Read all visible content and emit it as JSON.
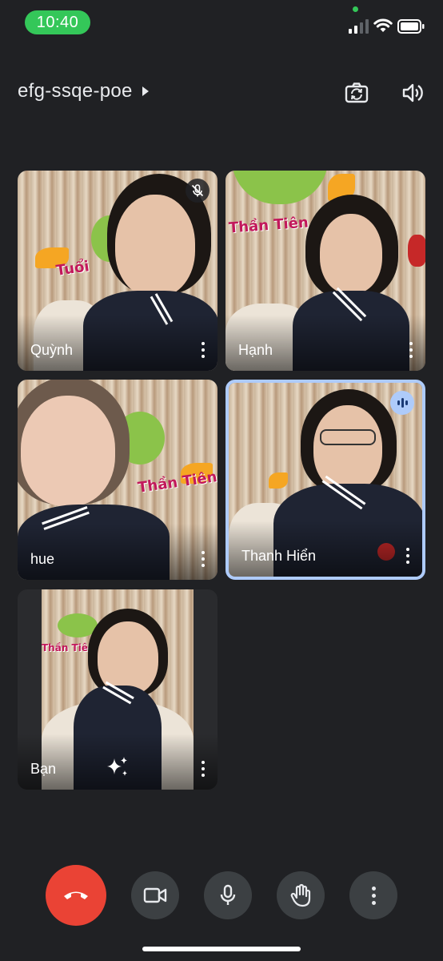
{
  "status_bar": {
    "time": "10:40"
  },
  "header": {
    "meeting_code": "efg-ssqe-poe"
  },
  "participants": [
    {
      "name": "Quỳnh",
      "muted": true,
      "speaking": false
    },
    {
      "name": "Hạnh",
      "muted": false,
      "speaking": false
    },
    {
      "name": "hue",
      "muted": false,
      "speaking": false
    },
    {
      "name": "Thanh Hiển",
      "muted": false,
      "speaking": true
    },
    {
      "name": "Bạn",
      "muted": false,
      "speaking": false,
      "self": true
    }
  ],
  "backdrop_text": [
    "Tuổi",
    "Thần Tiên"
  ],
  "icons": {
    "flip_camera": "camera-flip-icon",
    "speaker": "volume-icon",
    "muted": "mic-off-icon",
    "speaking": "audio-level-icon",
    "effects": "sparkle-icon",
    "end_call": "phone-hangup-icon",
    "camera": "videocam-icon",
    "microphone": "mic-icon",
    "raise_hand": "hand-icon",
    "more": "more-vert-icon"
  },
  "colors": {
    "background": "#202124",
    "time_pill": "#34c759",
    "end_call": "#ea4335",
    "control_bg": "#3c4043",
    "active_speaker_border": "#aecbfa"
  }
}
